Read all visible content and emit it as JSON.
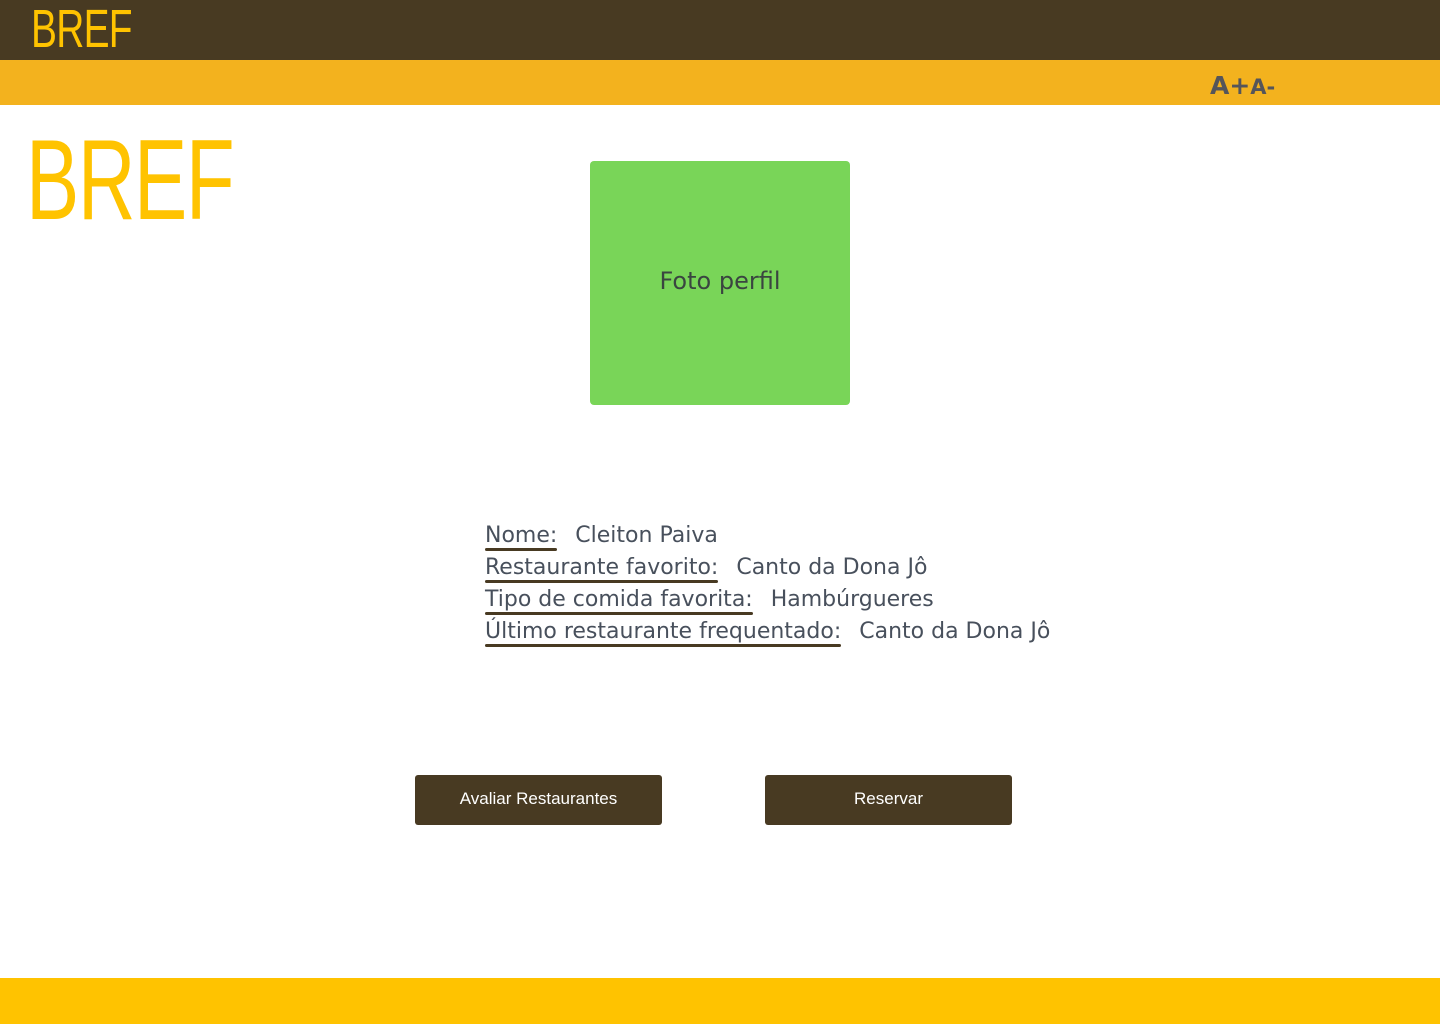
{
  "header": {
    "logo_text": "BREF",
    "background_color": "#483a22",
    "logo_color": "#ffc300"
  },
  "accessibility_bar": {
    "increase_font_label": "A+",
    "decrease_font_label": "A-",
    "background_color": "#f3b21e"
  },
  "main": {
    "logo_text": "BREF",
    "photo": {
      "label": "Foto perfil",
      "color": "#79d558"
    },
    "profile": {
      "rows": [
        {
          "label": "Nome:",
          "value": "Cleiton Paiva"
        },
        {
          "label": "Restaurante favorito:",
          "value": "Canto da Dona Jô"
        },
        {
          "label": "Tipo de comida favorita:",
          "value": "Hambúrgueres"
        },
        {
          "label": "Último restaurante frequentado:",
          "value": "Canto da Dona Jô"
        }
      ]
    },
    "buttons": {
      "rate_label": "Avaliar Restaurantes",
      "reserve_label": "Reservar"
    }
  },
  "footer": {
    "background_color": "#ffc300"
  }
}
